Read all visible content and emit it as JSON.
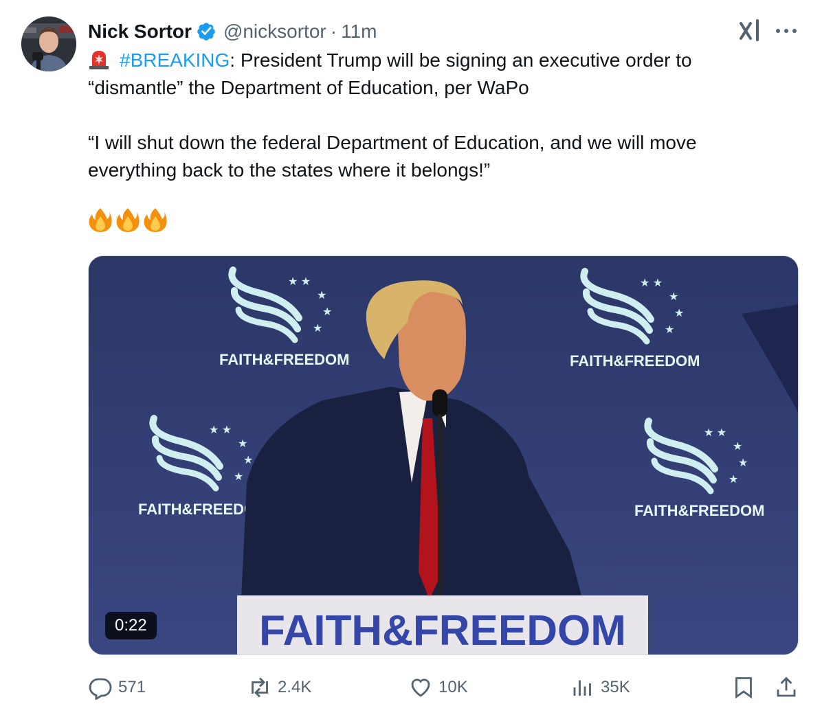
{
  "author": {
    "name": "Nick Sortor",
    "handle": "@nicksortor",
    "separator": "·",
    "time": "11m",
    "verified": true,
    "verified_color": "#1d9bf0"
  },
  "header_icons": [
    "grok-icon",
    "more-icon"
  ],
  "body": {
    "emoji_lead": "siren-icon",
    "hashtag": "#BREAKING",
    "line1_rest": ": President Trump will be signing an executive order to “dismantle” the Department of Education, per WaPo",
    "quote": "“I will shut down the federal Department of Education, and we will move everything back to the states where it belongs!”",
    "emoji_trailer": [
      "fire-icon",
      "fire-icon",
      "fire-icon"
    ]
  },
  "media": {
    "type": "video",
    "duration": "0:22",
    "banner_text": "FAITH&FREEDOM",
    "podium_text": "FAITH&FREEDOM"
  },
  "actions": {
    "replies": "571",
    "reposts": "2.4K",
    "likes": "10K",
    "views": "35K"
  },
  "colors": {
    "accent": "#1d9bf0",
    "secondary_text": "#536471",
    "primary_text": "#0f1419"
  }
}
